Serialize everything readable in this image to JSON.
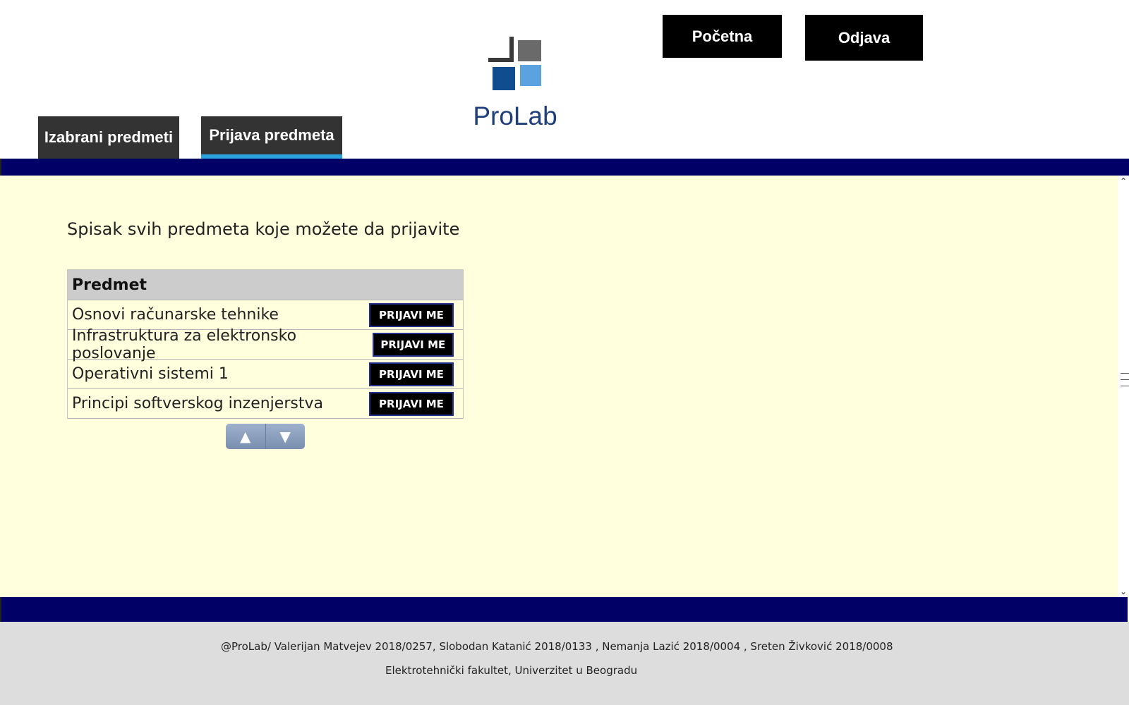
{
  "header": {
    "home_label": "Početna",
    "logout_label": "Odjava",
    "logo_text": "ProLab",
    "tabs": [
      {
        "label": "Izabrani predmeti"
      },
      {
        "label": "Prijava predmeta"
      }
    ]
  },
  "main": {
    "heading": "Spisak svih predmeta koje možete da prijavite",
    "table": {
      "header": "Predmet",
      "rows": [
        {
          "name": "Osnovi računarske tehnike",
          "action": "PRIJAVI ME"
        },
        {
          "name": "Infrastruktura za elektronsko poslovanje",
          "action": "PRIJAVI ME"
        },
        {
          "name": "Operativni sistemi 1",
          "action": "PRIJAVI ME"
        },
        {
          "name": "Principi softverskog inzenjerstva",
          "action": "PRIJAVI ME"
        }
      ]
    },
    "pager": {
      "up_icon": "▲",
      "down_icon": "▼"
    }
  },
  "footer": {
    "authors": "@ProLab/ Valerijan Matvejev 2018/0257, Slobodan Katanić 2018/0133 , Nemanja Lazić 2018/0004 , Sreten Živković 2018/0008",
    "school": "Elektrotehnički fakultet, Univerzitet u Beogradu"
  },
  "colors": {
    "navy_bar": "#000066",
    "main_bg": "#ffffdd",
    "tab_bg": "#333333",
    "tab_active_underline": "#2aa3dd",
    "footer_bg": "#dddddd"
  }
}
